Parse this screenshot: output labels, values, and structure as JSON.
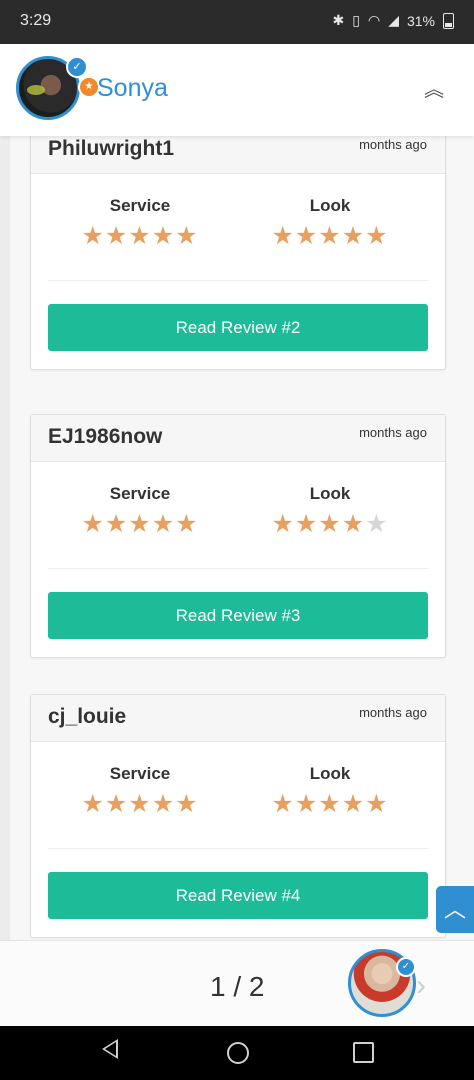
{
  "status_bar": {
    "time": "3:29",
    "battery": "31%"
  },
  "header": {
    "name": "Sonya"
  },
  "reviews": [
    {
      "reviewer": "Philuwright1",
      "when": "months ago",
      "service_label": "Service",
      "look_label": "Look",
      "service_stars": 5,
      "look_stars": 5,
      "button": "Read Review #2"
    },
    {
      "reviewer": "EJ1986now",
      "when": "months ago",
      "service_label": "Service",
      "look_label": "Look",
      "service_stars": 5,
      "look_stars": 4,
      "button": "Read Review #3"
    },
    {
      "reviewer": "cj_louie",
      "when": "months ago",
      "service_label": "Service",
      "look_label": "Look",
      "service_stars": 5,
      "look_stars": 5,
      "button": "Read Review #4"
    }
  ],
  "pager": {
    "indicator": "1 / 2"
  },
  "colors": {
    "accent": "#1dbc99",
    "brand": "#2f8fd0",
    "star": "#e8a060"
  }
}
